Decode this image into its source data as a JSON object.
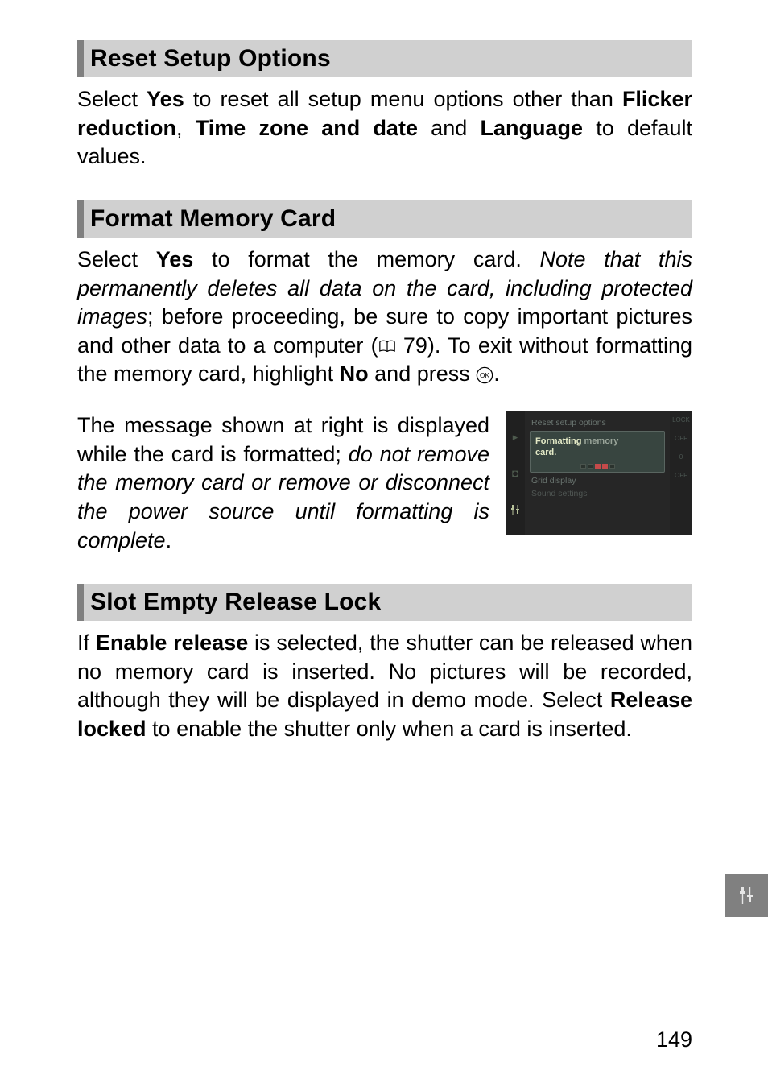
{
  "sections": {
    "reset": {
      "title": "Reset Setup Options",
      "para": {
        "pre": "Select ",
        "yes": "Yes",
        "mid1": " to reset all setup menu options other than ",
        "flicker": "Flicker reduction",
        "comma": ", ",
        "tz": "Time zone and date",
        "and": " and ",
        "lang": "Language",
        "post": " to default values."
      }
    },
    "format": {
      "title": "Format Memory Card",
      "para1": {
        "pre": "Select ",
        "yes": "Yes",
        "mid1": " to format the memory card. ",
        "ital": "Note that this permanently deletes all data on the card, including protected images",
        "mid2": "; before proceeding, be sure to copy important pictures and other data to a computer (",
        "ref": " 79). To exit without formatting the memory card, highlight ",
        "no": "No",
        "post": " and press "
      },
      "para2": {
        "pre": "The message shown at right is displayed while the card is formatted; ",
        "ital": "do not remove the memory card or remove or disconnect the power source until formatting is complete",
        "post": "."
      },
      "camera": {
        "menu_top": "Reset setup options",
        "popup_line": "Formatting memory card.",
        "menu_bottom1": "Grid display",
        "menu_bottom2": "Sound settings",
        "right": {
          "r1": "LOCK",
          "r2": "OFF",
          "r3": "0",
          "r4": "OFF"
        }
      }
    },
    "slot": {
      "title": "Slot Empty Release Lock",
      "para": {
        "pre": "If ",
        "enable": "Enable release",
        "mid1": " is selected, the shutter can be released when no memory card is inserted. No pictures will be recorded, although they will be displayed in demo mode. Select ",
        "release": "Release locked",
        "post": " to enable the shutter only when a card is inserted."
      }
    }
  },
  "page_number": "149"
}
